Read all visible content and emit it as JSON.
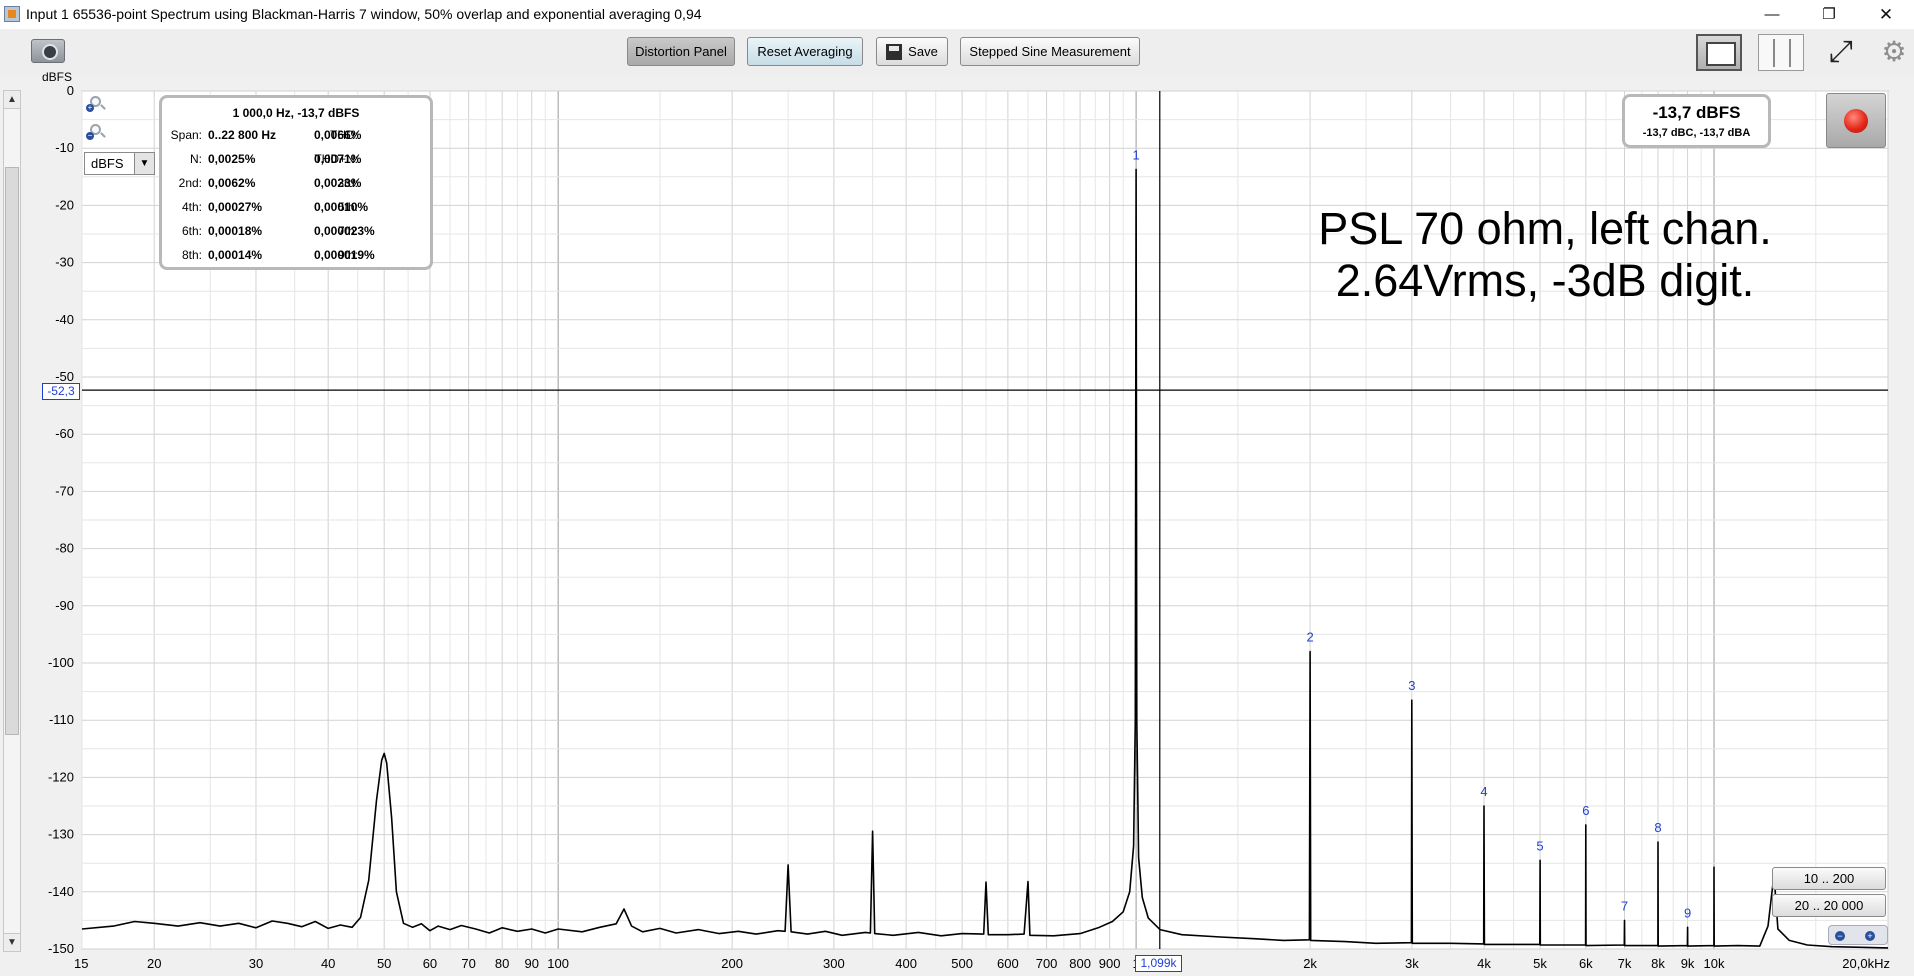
{
  "window": {
    "title": "Input 1 65536-point Spectrum using Blackman-Harris 7 window, 50% overlap and exponential averaging 0,94",
    "minimize_glyph": "—",
    "restore_glyph": "❐",
    "close_glyph": "✕"
  },
  "toolbar": {
    "distortion_panel": "Distortion Panel",
    "reset_averaging": "Reset Averaging",
    "save": "Save",
    "stepped_sine": "Stepped Sine Measurement",
    "fit_glyph": "⤢",
    "gear_glyph": "⚙"
  },
  "icons": [
    "camera-icon",
    "save-icon",
    "single-graph-view-icon",
    "split-view-icon",
    "fit-view-icon",
    "gear-icon",
    "zoom-in-icon",
    "zoom-out-icon",
    "record-icon"
  ],
  "unit_label": "dBFS",
  "unit_select": {
    "value": "dBFS",
    "arrow": "▼"
  },
  "scrollbar": {
    "up": "▲",
    "down": "▼"
  },
  "distortion": {
    "header": "1 000,0 Hz, -13,7 dBFS",
    "rows": [
      [
        {
          "k": "Span:",
          "v": "0..22 800 Hz"
        },
        {
          "k": "THD:",
          "v": "0,0066%"
        }
      ],
      [
        {
          "k": "N:",
          "v": "0,0025%"
        },
        {
          "k": "THD+N:",
          "v": "0,0071%"
        }
      ],
      [
        {
          "k": "2nd:",
          "v": "0,0062%"
        },
        {
          "k": "3rd:",
          "v": "0,0023%"
        }
      ],
      [
        {
          "k": "4th:",
          "v": "0,00027%"
        },
        {
          "k": "5th:",
          "v": "0,00010%"
        }
      ],
      [
        {
          "k": "6th:",
          "v": "0,00018%"
        },
        {
          "k": "7th:",
          "v": "0,000023%"
        }
      ],
      [
        {
          "k": "8th:",
          "v": "0,00014%"
        },
        {
          "k": "9th:",
          "v": "0,000019%"
        }
      ]
    ]
  },
  "level": {
    "main": "-13,7 dBFS",
    "sub": "-13,7 dBC, -13,7 dBA"
  },
  "annotation": {
    "line1": "PSL 70 ohm, left chan.",
    "line2": "2.64Vrms, -3dB digit."
  },
  "cursor": {
    "y_label": "-52,3",
    "x_label": "1,099k",
    "x_hz": 1099,
    "y_db": -52.3
  },
  "range_buttons": {
    "a": "10 .. 200",
    "b": "20 .. 20 000"
  },
  "hzoom": {
    "out": "−",
    "in": "+"
  },
  "chart_data": {
    "type": "line",
    "x_scale": "log",
    "xlim": [
      15,
      20000
    ],
    "ylim": [
      -150,
      0
    ],
    "ylabel": "dBFS",
    "grid": true,
    "y_ticks": [
      {
        "v": 0,
        "label": "0"
      },
      {
        "v": -10,
        "label": "-10"
      },
      {
        "v": -20,
        "label": "-20"
      },
      {
        "v": -30,
        "label": "-30"
      },
      {
        "v": -40,
        "label": "-40"
      },
      {
        "v": -50,
        "label": "-50"
      },
      {
        "v": -60,
        "label": "-60"
      },
      {
        "v": -70,
        "label": "-70"
      },
      {
        "v": -80,
        "label": "-80"
      },
      {
        "v": -90,
        "label": "-90"
      },
      {
        "v": -100,
        "label": "-100"
      },
      {
        "v": -110,
        "label": "-110"
      },
      {
        "v": -120,
        "label": "-120"
      },
      {
        "v": -130,
        "label": "-130"
      },
      {
        "v": -140,
        "label": "-140"
      },
      {
        "v": -150,
        "label": "-150"
      }
    ],
    "x_ticks": [
      {
        "v": 15,
        "label": "15"
      },
      {
        "v": 20,
        "label": "20"
      },
      {
        "v": 30,
        "label": "30"
      },
      {
        "v": 40,
        "label": "40"
      },
      {
        "v": 50,
        "label": "50"
      },
      {
        "v": 60,
        "label": "60"
      },
      {
        "v": 70,
        "label": "70"
      },
      {
        "v": 80,
        "label": "80"
      },
      {
        "v": 90,
        "label": "90"
      },
      {
        "v": 100,
        "label": "100"
      },
      {
        "v": 200,
        "label": "200"
      },
      {
        "v": 300,
        "label": "300"
      },
      {
        "v": 400,
        "label": "400"
      },
      {
        "v": 500,
        "label": "500"
      },
      {
        "v": 600,
        "label": "600"
      },
      {
        "v": 700,
        "label": "700"
      },
      {
        "v": 800,
        "label": "800"
      },
      {
        "v": 900,
        "label": "900"
      },
      {
        "v": 1000,
        "label": "1"
      },
      {
        "v": 2000,
        "label": "2k"
      },
      {
        "v": 3000,
        "label": "3k"
      },
      {
        "v": 4000,
        "label": "4k"
      },
      {
        "v": 5000,
        "label": "5k"
      },
      {
        "v": 6000,
        "label": "6k"
      },
      {
        "v": 7000,
        "label": "7k"
      },
      {
        "v": 8000,
        "label": "8k"
      },
      {
        "v": 9000,
        "label": "9k"
      },
      {
        "v": 10000,
        "label": "10k"
      },
      {
        "v": 20000,
        "label": "20,0kHz"
      }
    ],
    "series": [
      {
        "points": [
          [
            15,
            -146.5
          ],
          [
            17,
            -146
          ],
          [
            18.5,
            -145.2
          ],
          [
            20,
            -145.5
          ],
          [
            22,
            -146
          ],
          [
            24,
            -145.4
          ],
          [
            26,
            -146
          ],
          [
            28,
            -145.5
          ],
          [
            30,
            -146.3
          ],
          [
            32,
            -145.1
          ],
          [
            34,
            -145.5
          ],
          [
            36,
            -146.1
          ],
          [
            38,
            -145.2
          ],
          [
            40,
            -146.4
          ],
          [
            42,
            -145.8
          ],
          [
            44,
            -146.2
          ],
          [
            45.5,
            -144.5
          ],
          [
            47,
            -138
          ],
          [
            48.5,
            -124
          ],
          [
            49.5,
            -117
          ],
          [
            50,
            -115.8
          ],
          [
            50.5,
            -117.5
          ],
          [
            51.5,
            -127
          ],
          [
            52.5,
            -140
          ],
          [
            54,
            -145.5
          ],
          [
            56,
            -146.2
          ],
          [
            58,
            -145.6
          ],
          [
            60,
            -146.8
          ],
          [
            62,
            -146
          ],
          [
            65,
            -146.6
          ],
          [
            68,
            -145.9
          ],
          [
            72,
            -146.5
          ],
          [
            76,
            -147.2
          ],
          [
            80,
            -146.3
          ],
          [
            85,
            -146.9
          ],
          [
            90,
            -146.5
          ],
          [
            95,
            -147.2
          ],
          [
            100,
            -146.5
          ],
          [
            110,
            -147
          ],
          [
            118,
            -146.2
          ],
          [
            126,
            -145.6
          ],
          [
            130,
            -143
          ],
          [
            134,
            -146
          ],
          [
            140,
            -147
          ],
          [
            150,
            -146.4
          ],
          [
            160,
            -147.2
          ],
          [
            175,
            -146.6
          ],
          [
            190,
            -147.3
          ],
          [
            205,
            -146.9
          ],
          [
            220,
            -147.4
          ],
          [
            240,
            -146.8
          ],
          [
            247,
            -146.9
          ],
          [
            250,
            -135.3
          ],
          [
            253,
            -147
          ],
          [
            270,
            -147.4
          ],
          [
            290,
            -146.9
          ],
          [
            310,
            -147.6
          ],
          [
            340,
            -147.1
          ],
          [
            347,
            -147.2
          ],
          [
            350,
            -129.4
          ],
          [
            353,
            -147.3
          ],
          [
            380,
            -147.6
          ],
          [
            420,
            -147.1
          ],
          [
            460,
            -147.7
          ],
          [
            500,
            -147.3
          ],
          [
            545,
            -147.4
          ],
          [
            550,
            -138.3
          ],
          [
            555,
            -147.5
          ],
          [
            600,
            -147.5
          ],
          [
            640,
            -147.4
          ],
          [
            650,
            -138.2
          ],
          [
            655,
            -147.6
          ],
          [
            720,
            -147.7
          ],
          [
            800,
            -147.3
          ],
          [
            860,
            -146.3
          ],
          [
            910,
            -145.2
          ],
          [
            950,
            -143.5
          ],
          [
            975,
            -140
          ],
          [
            990,
            -132
          ],
          [
            997,
            -110
          ],
          [
            1000,
            -13.7
          ],
          [
            1003,
            -110
          ],
          [
            1010,
            -134
          ],
          [
            1025,
            -141
          ],
          [
            1050,
            -144.6
          ],
          [
            1100,
            -146.6
          ],
          [
            1200,
            -147.5
          ],
          [
            1400,
            -147.9
          ],
          [
            1600,
            -148.2
          ],
          [
            1800,
            -148.5
          ],
          [
            1995,
            -148.4
          ],
          [
            2000,
            -98
          ],
          [
            2005,
            -148.5
          ],
          [
            2300,
            -148.7
          ],
          [
            2600,
            -149
          ],
          [
            2995,
            -148.9
          ],
          [
            3000,
            -106.5
          ],
          [
            3005,
            -149
          ],
          [
            3500,
            -149
          ],
          [
            3995,
            -149.1
          ],
          [
            4000,
            -125
          ],
          [
            4005,
            -149.2
          ],
          [
            4500,
            -149.2
          ],
          [
            4995,
            -149.2
          ],
          [
            5000,
            -134.5
          ],
          [
            5005,
            -149.3
          ],
          [
            5500,
            -149.3
          ],
          [
            5995,
            -149.3
          ],
          [
            6000,
            -128.3
          ],
          [
            6005,
            -149.4
          ],
          [
            6995,
            -149.3
          ],
          [
            7000,
            -145
          ],
          [
            7005,
            -149.4
          ],
          [
            7995,
            -149.4
          ],
          [
            8000,
            -131.3
          ],
          [
            8005,
            -149.5
          ],
          [
            8995,
            -149.4
          ],
          [
            9000,
            -146.2
          ],
          [
            9005,
            -149.5
          ],
          [
            9995,
            -149.4
          ],
          [
            10000,
            -135.7
          ],
          [
            10005,
            -149.5
          ],
          [
            11000,
            -149.4
          ],
          [
            12000,
            -149.5
          ],
          [
            12400,
            -146
          ],
          [
            12700,
            -137
          ],
          [
            12900,
            -146.5
          ],
          [
            13500,
            -148.5
          ],
          [
            14500,
            -149.3
          ],
          [
            16000,
            -149.6
          ],
          [
            18000,
            -149.7
          ],
          [
            20000,
            -149.8
          ]
        ]
      }
    ],
    "harmonic_markers": [
      {
        "label": "1",
        "x": 1000,
        "y": -13.7
      },
      {
        "label": "2",
        "x": 2000,
        "y": -98
      },
      {
        "label": "3",
        "x": 3000,
        "y": -106.5
      },
      {
        "label": "4",
        "x": 4000,
        "y": -125
      },
      {
        "label": "5",
        "x": 5000,
        "y": -134.5
      },
      {
        "label": "6",
        "x": 6000,
        "y": -128.3
      },
      {
        "label": "7",
        "x": 7000,
        "y": -145
      },
      {
        "label": "8",
        "x": 8000,
        "y": -131.3
      },
      {
        "label": "9",
        "x": 9000,
        "y": -146.2
      }
    ],
    "colors": {
      "trace": "#000000",
      "marker_label": "#1f3fd4",
      "grid": "#d2d2d2",
      "grid_major": "#9a9a9a",
      "cursor": "#000000"
    }
  }
}
